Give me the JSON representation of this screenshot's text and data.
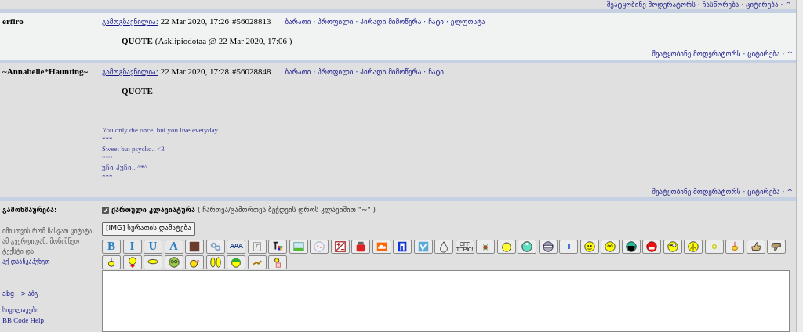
{
  "top_actions": {
    "links": [
      "შეატყობინე მოდერატორს",
      "ჩასწორება",
      "ციტირება",
      "^"
    ],
    "separator": "·"
  },
  "posts": [
    {
      "author": "erfiro",
      "highlight": true,
      "posted_label": "გამოგზავნილია:",
      "date": "22 Mar 2020, 17:26",
      "number": "#56028813",
      "links": [
        "ბარათი",
        "პროფილი",
        "პირადი მიმოწერა",
        "ჩატი",
        "ელფოსტა"
      ],
      "quote_label": "QUOTE",
      "quote_source": "(Asklipiodotaa @ 22 Mar 2020, 17:06 )",
      "footer_links": [
        "შეატყობინე მოდერატორს",
        "ციტირება",
        "^"
      ]
    },
    {
      "author": "~Annabelle*Haunting~",
      "highlight": false,
      "posted_label": "გამოგზავნილია:",
      "date": "22 Mar 2020, 17:28",
      "number": "#56028848",
      "links": [
        "ბარათი",
        "პროფილი",
        "პირადი მიმოწერა",
        "ჩატი"
      ],
      "quote_label": "QUOTE",
      "signature_rule": "--------------------",
      "signature": [
        "You only die once, but you live everyday.",
        "***",
        "Sweet but psycho.. <3",
        "***",
        "უჩი-პუჩი.. ^*^",
        "***"
      ],
      "footer_links": [
        "შეატყობინე მოდერატორს",
        "ციტირება",
        "^"
      ]
    }
  ],
  "separator": "·",
  "reply": {
    "label": "გამოხმაურება:",
    "help_text": "იმისთვის რომ ჩასვათ ციტატა ამ გვერდიდან, მონიშნეთ ტექსტი და",
    "help_link": "აქ დააწკაპუნეთ",
    "translit": "abg --> აბგ",
    "smilies_link": "სიცილაკები",
    "bbcode_link": "BB Code Help",
    "keyboard": {
      "checked": true,
      "label": "ქართული კლავიატურა",
      "hint": "( ჩართვა/გამორთვა ბეჭდვის დროს კლავიშით \"~\" )"
    },
    "img_button": "[IMG] სურათის დამატება",
    "toolbar_rows": [
      [
        {
          "kind": "text",
          "label": "B"
        },
        {
          "kind": "text",
          "label": "I"
        },
        {
          "kind": "text",
          "label": "U"
        },
        {
          "kind": "text",
          "label": "A"
        },
        {
          "kind": "icon"
        },
        {
          "kind": "icon"
        },
        {
          "kind": "text",
          "label": "AAA"
        },
        {
          "kind": "icon"
        },
        {
          "kind": "icon"
        },
        {
          "kind": "icon"
        },
        {
          "kind": "icon"
        },
        {
          "kind": "icon"
        },
        {
          "kind": "icon"
        },
        {
          "kind": "icon"
        },
        {
          "kind": "icon"
        },
        {
          "kind": "icon"
        },
        {
          "kind": "icon"
        },
        {
          "kind": "text",
          "label": "OFF TOPIC!"
        },
        {
          "kind": "icon"
        },
        {
          "kind": "icon"
        },
        {
          "kind": "icon"
        },
        {
          "kind": "icon"
        },
        {
          "kind": "icon"
        },
        {
          "kind": "icon"
        },
        {
          "kind": "icon"
        },
        {
          "kind": "icon"
        },
        {
          "kind": "icon"
        },
        {
          "kind": "icon"
        },
        {
          "kind": "icon"
        },
        {
          "kind": "icon"
        },
        {
          "kind": "icon"
        },
        {
          "kind": "icon"
        },
        {
          "kind": "icon"
        }
      ],
      [
        {
          "kind": "icon"
        },
        {
          "kind": "icon"
        },
        {
          "kind": "icon"
        },
        {
          "kind": "icon"
        },
        {
          "kind": "icon"
        },
        {
          "kind": "icon"
        },
        {
          "kind": "icon"
        },
        {
          "kind": "icon"
        },
        {
          "kind": "icon"
        }
      ]
    ]
  }
}
